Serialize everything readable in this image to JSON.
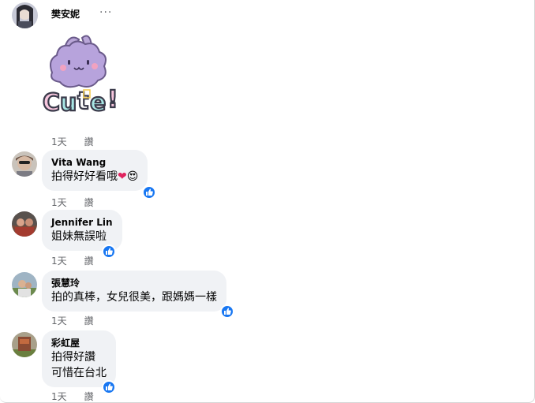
{
  "post": {
    "author": "樊安妮",
    "more": "···",
    "sticker_text": "Cute!",
    "time": "1天",
    "action": "讚"
  },
  "comments": [
    {
      "author": "Vita Wang",
      "lines": [
        "拍得好好看哦"
      ],
      "emoji": [
        "❤",
        "😍"
      ],
      "time": "1天",
      "action": "讚"
    },
    {
      "author": "Jennifer Lin",
      "lines": [
        "姐妹無誤啦"
      ],
      "time": "1天",
      "action": "讚"
    },
    {
      "author": "張慧玲",
      "lines": [
        "拍的真棒，女兒很美，跟媽媽一樣"
      ],
      "time": "1天",
      "action": "讚"
    },
    {
      "author": "彩虹屋",
      "lines": [
        "拍得好讚",
        "可惜在台北"
      ],
      "time": "1天",
      "action": "讚"
    }
  ],
  "colors": {
    "bubble": "#f0f2f5",
    "like": "#1877f2",
    "meta": "#65676b"
  }
}
